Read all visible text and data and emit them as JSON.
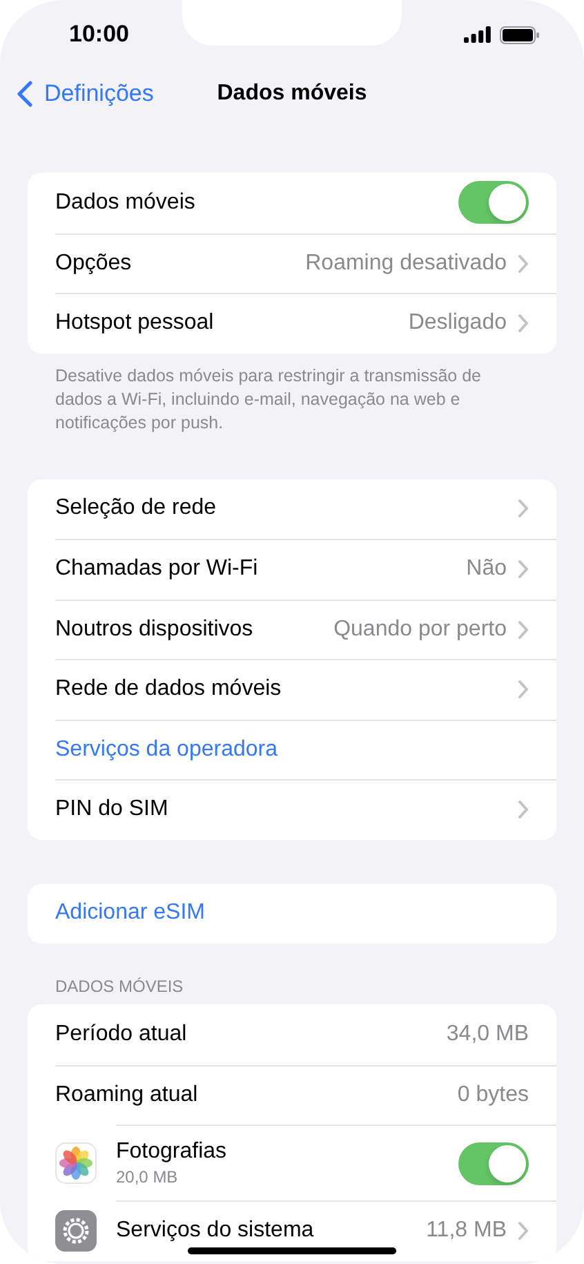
{
  "status_bar": {
    "time": "10:00"
  },
  "nav": {
    "back": "Definições",
    "title": "Dados móveis"
  },
  "sections": [
    {
      "rows": [
        {
          "kind": "toggle",
          "label": "Dados móveis",
          "on": true
        },
        {
          "kind": "detail",
          "label": "Opções",
          "value": "Roaming desativado"
        },
        {
          "kind": "detail",
          "label": "Hotspot pessoal",
          "value": "Desligado"
        }
      ],
      "footer": "Desative dados móveis para restringir a transmissão de dados a Wi-Fi, incluindo e-mail, navegação na web e notificações por push."
    },
    {
      "rows": [
        {
          "kind": "detail",
          "label": "Seleção de rede"
        },
        {
          "kind": "detail",
          "label": "Chamadas por Wi-Fi",
          "value": "Não"
        },
        {
          "kind": "detail",
          "label": "Noutros dispositivos",
          "value": "Quando por perto"
        },
        {
          "kind": "detail",
          "label": "Rede de dados móveis"
        },
        {
          "kind": "action",
          "label": "Serviços da operadora"
        },
        {
          "kind": "detail",
          "label": "PIN do SIM"
        }
      ]
    },
    {
      "rows": [
        {
          "kind": "action",
          "label": "Adicionar eSIM"
        }
      ]
    },
    {
      "header": "DADOS MÓVEIS",
      "rows": [
        {
          "kind": "value",
          "label": "Período atual",
          "value": "34,0 MB"
        },
        {
          "kind": "value",
          "label": "Roaming atual",
          "value": "0 bytes"
        },
        {
          "kind": "app",
          "label": "Fotografias",
          "sublabel": "20,0 MB",
          "on": true
        },
        {
          "kind": "system",
          "label": "Serviços do sistema",
          "value": "11,8 MB"
        }
      ]
    }
  ]
}
